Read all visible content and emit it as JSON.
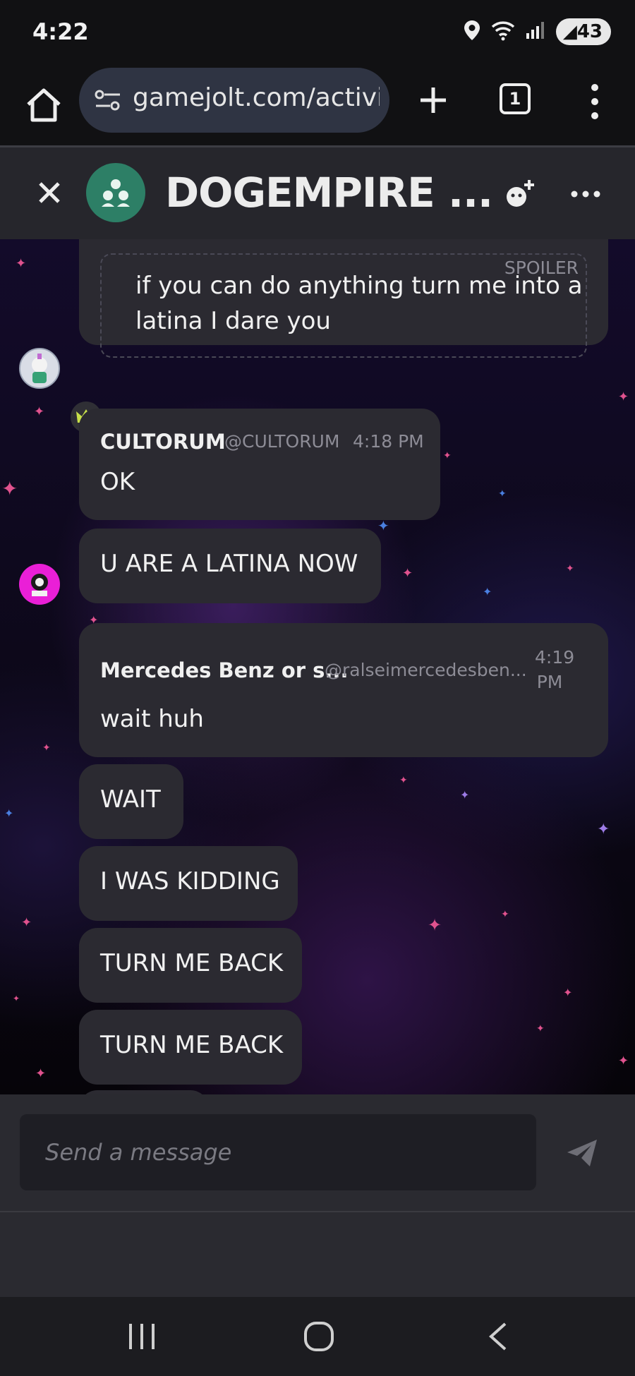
{
  "status_bar": {
    "time": "4:22",
    "battery": "43"
  },
  "browser": {
    "url": "gamejolt.com/activity",
    "tab_count": "1"
  },
  "chat_header": {
    "title": "DOGEMPIRE ..."
  },
  "messages": {
    "spoiler_label": "SPOILER",
    "spoiler_line1": "if you can do anything turn me into a",
    "spoiler_line2": "latina I dare you",
    "m1_author": "CULTORUM",
    "m1_handle": "@CULTORUM",
    "m1_time": "4:18 PM",
    "m1_text": "OK",
    "m2_text": "U ARE A LATINA NOW",
    "m3_author": "Mercedes Benz or s...",
    "m3_handle": "@ralseimercedesben...",
    "m3_time_line1": "4:19",
    "m3_time_line2": "PM",
    "m3_text": "wait huh",
    "m4_text": "WAIT",
    "m5_text": "I WAS KIDDING",
    "m6_text": "TURN ME BACK",
    "m7_text": "TURN ME BACK"
  },
  "composer": {
    "placeholder": "Send a message"
  },
  "colors": {
    "header_bg": "#26262c",
    "bubble_bg": "#2b2a31",
    "group_avatar": "#2d7f66",
    "crown": "#c8e04a",
    "url_bar": "#2f3443"
  },
  "icons": [
    "location-icon",
    "wifi-icon",
    "signal-icon",
    "home-icon",
    "site-settings-icon",
    "plus-icon",
    "tab-switcher-icon",
    "overflow-menu-icon",
    "close-icon",
    "group-icon",
    "add-member-icon",
    "more-icon",
    "crown-icon",
    "send-icon",
    "recents-icon",
    "home-circle-icon",
    "back-icon"
  ]
}
